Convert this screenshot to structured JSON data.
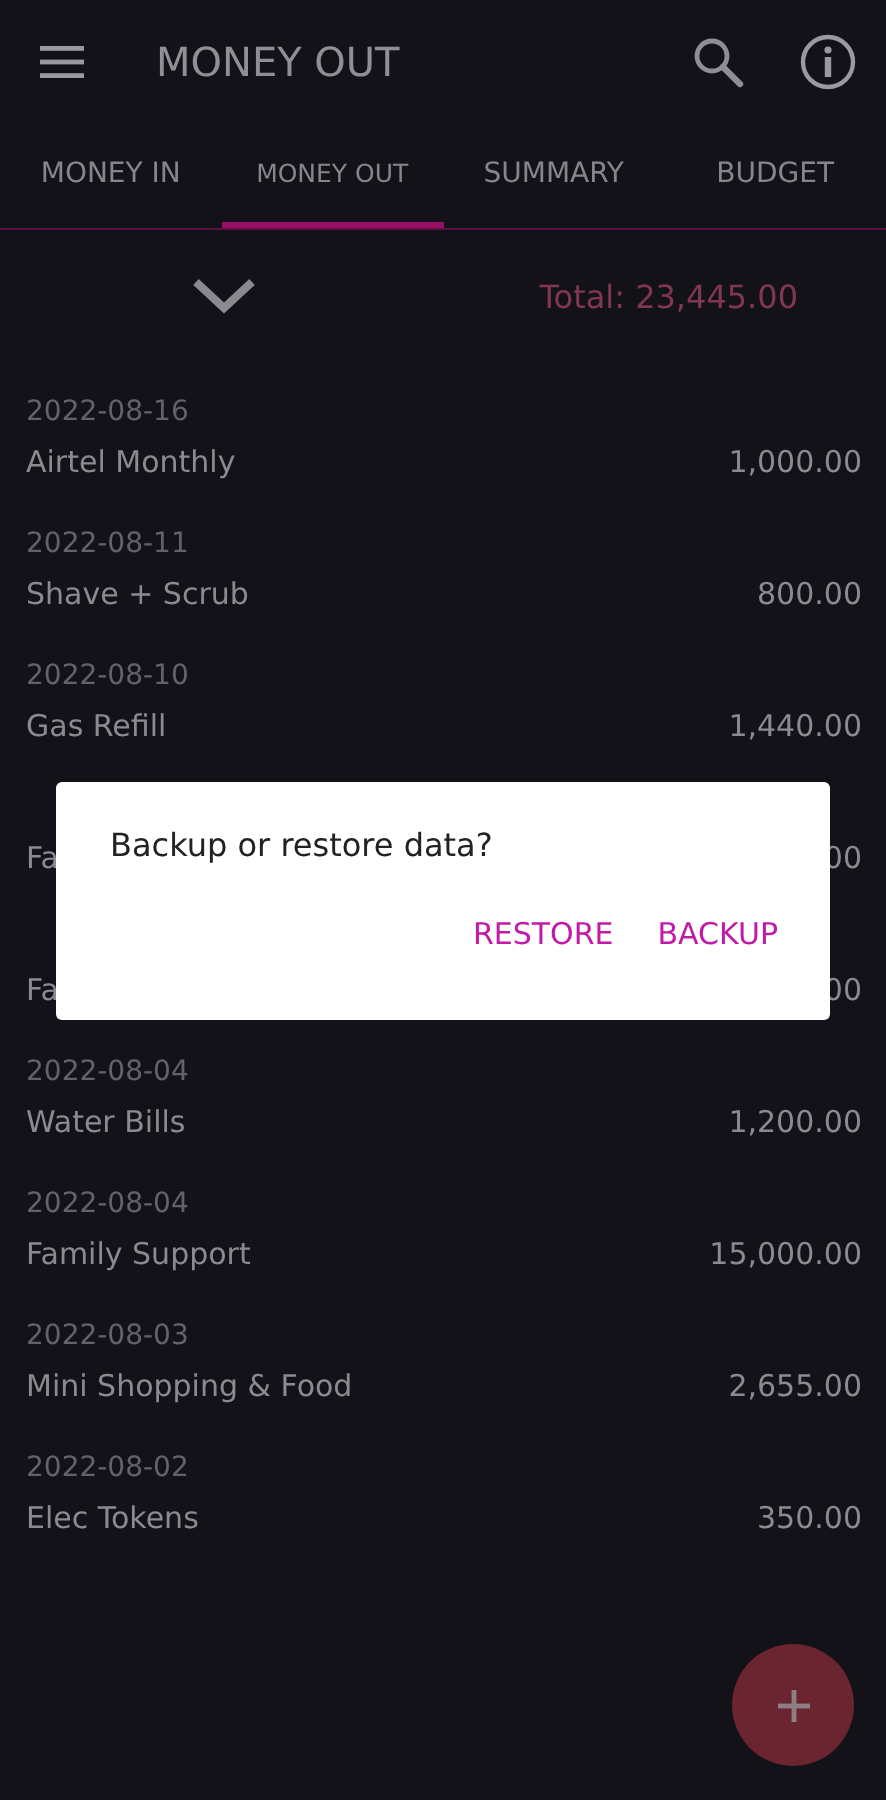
{
  "app_bar": {
    "title": "MONEY OUT"
  },
  "tabs": [
    {
      "label": "MONEY IN",
      "selected": false
    },
    {
      "label": "MONEY OUT",
      "selected": true
    },
    {
      "label": "SUMMARY",
      "selected": false
    },
    {
      "label": "BUDGET",
      "selected": false
    }
  ],
  "total": "Total: 23,445.00",
  "entries": [
    {
      "date": "2022-08-16",
      "name": "Airtel Monthly",
      "amount": "1,000.00"
    },
    {
      "date": "2022-08-11",
      "name": "Shave + Scrub",
      "amount": "800.00"
    },
    {
      "date": "2022-08-10",
      "name": "Gas Refill",
      "amount": "1,440.00"
    },
    {
      "name": "Fa",
      "amount": "00"
    },
    {
      "name": "Fa",
      "amount": "00"
    },
    {
      "date": "2022-08-04",
      "name": "Water Bills",
      "amount": "1,200.00"
    },
    {
      "date": "2022-08-04",
      "name": "Family Support",
      "amount": "15,000.00"
    },
    {
      "date": "2022-08-03",
      "name": "Mini Shopping & Food",
      "amount": "2,655.00"
    },
    {
      "date": "2022-08-02",
      "name": "Elec Tokens",
      "amount": "350.00"
    }
  ],
  "dialog": {
    "message": "Backup or restore data?",
    "buttons": [
      "RESTORE",
      "BACKUP"
    ]
  }
}
